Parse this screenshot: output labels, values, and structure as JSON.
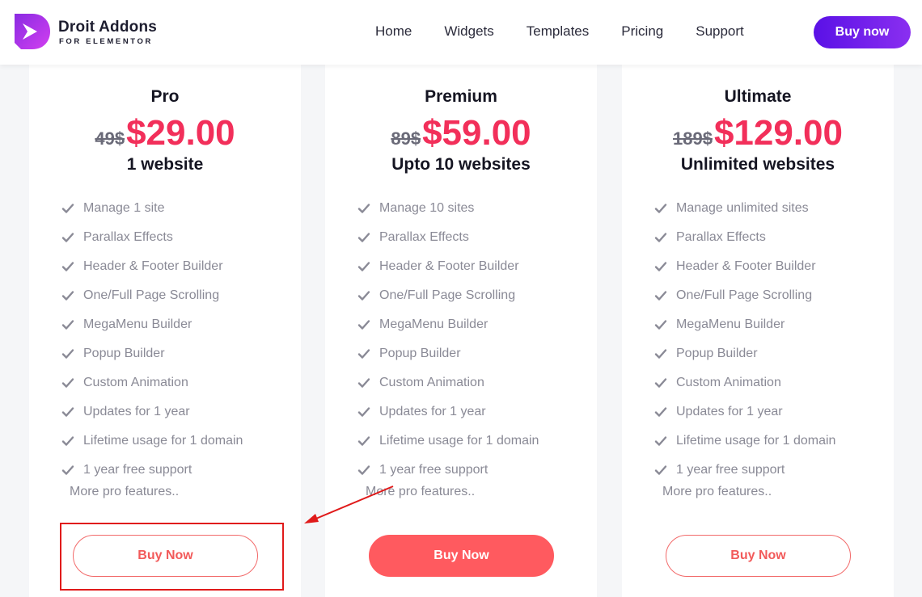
{
  "header": {
    "brand_name": "Droit Addons",
    "brand_tag": "FOR ELEMENTOR",
    "nav": [
      "Home",
      "Widgets",
      "Templates",
      "Pricing",
      "Support"
    ],
    "buy_label": "Buy now"
  },
  "colors": {
    "accent_purple": "#5a11e6",
    "price_red": "#f22f5a",
    "button_red": "#ff5a5f",
    "annotation_red": "#e01a1a"
  },
  "plans": [
    {
      "name": "Pro",
      "old_price": "49$",
      "price": "$29.00",
      "websites": "1 website",
      "features": [
        "Manage 1 site",
        "Parallax Effects",
        "Header & Footer Builder",
        "One/Full Page Scrolling",
        "MegaMenu Builder",
        "Popup Builder",
        "Custom Animation",
        "Updates for 1 year",
        "Lifetime usage for 1 domain",
        "1 year free support"
      ],
      "more": "More pro features..",
      "button": "Buy Now"
    },
    {
      "name": "Premium",
      "old_price": "89$",
      "price": "$59.00",
      "websites": "Upto 10 websites",
      "features": [
        "Manage 10 sites",
        "Parallax Effects",
        "Header & Footer Builder",
        "One/Full Page Scrolling",
        "MegaMenu Builder",
        "Popup Builder",
        "Custom Animation",
        "Updates for 1 year",
        "Lifetime usage for 1 domain",
        "1 year free support"
      ],
      "more": "More pro features..",
      "button": "Buy Now"
    },
    {
      "name": "Ultimate",
      "old_price": "189$",
      "price": "$129.00",
      "websites": "Unlimited websites",
      "features": [
        "Manage unlimited sites",
        "Parallax Effects",
        "Header & Footer Builder",
        "One/Full Page Scrolling",
        "MegaMenu Builder",
        "Popup Builder",
        "Custom Animation",
        "Updates for 1 year",
        "Lifetime usage for 1 domain",
        "1 year free support"
      ],
      "more": "More pro features..",
      "button": "Buy Now"
    }
  ]
}
